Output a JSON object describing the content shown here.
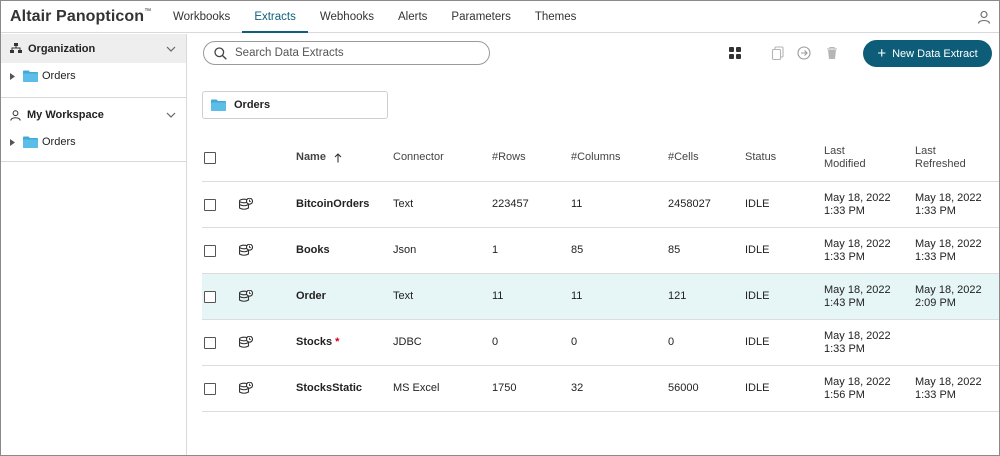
{
  "app": {
    "brand": "Altair Panopticon",
    "tabs": [
      {
        "label": "Workbooks"
      },
      {
        "label": "Extracts"
      },
      {
        "label": "Webhooks"
      },
      {
        "label": "Alerts"
      },
      {
        "label": "Parameters"
      },
      {
        "label": "Themes"
      }
    ],
    "active_tab": "Extracts"
  },
  "sidebar": {
    "organization": {
      "label": "Organization",
      "items": [
        {
          "label": "Orders"
        }
      ]
    },
    "workspace": {
      "label": "My Workspace",
      "items": [
        {
          "label": "Orders"
        }
      ]
    }
  },
  "toolbar": {
    "search_placeholder": "Search Data Extracts",
    "new_button_label": "New Data Extract"
  },
  "current_folder": "Orders",
  "table": {
    "headers": {
      "name": "Name",
      "connector": "Connector",
      "rows": "#Rows",
      "columns": "#Columns",
      "cells": "#Cells",
      "status": "Status",
      "modified_1": "Last",
      "modified_2": "Modified",
      "refreshed_1": "Last",
      "refreshed_2": "Refreshed"
    },
    "rows": [
      {
        "name": "BitcoinOrders",
        "required": "",
        "connector": "Text",
        "rows": "223457",
        "columns": "11",
        "cells": "2458027",
        "status": "IDLE",
        "modified_date": "May 18, 2022",
        "modified_time": "1:33 PM",
        "refreshed_date": "May 18, 2022",
        "refreshed_time": "1:33 PM"
      },
      {
        "name": "Books",
        "required": "",
        "connector": "Json",
        "rows": "1",
        "columns": "85",
        "cells": "85",
        "status": "IDLE",
        "modified_date": "May 18, 2022",
        "modified_time": "1:33 PM",
        "refreshed_date": "May 18, 2022",
        "refreshed_time": "1:33 PM"
      },
      {
        "name": "Order",
        "required": "",
        "connector": "Text",
        "rows": "11",
        "columns": "11",
        "cells": "121",
        "status": "IDLE",
        "modified_date": "May 18, 2022",
        "modified_time": "1:43 PM",
        "refreshed_date": "May 18, 2022",
        "refreshed_time": "2:09 PM"
      },
      {
        "name": "Stocks",
        "required": "*",
        "connector": "JDBC",
        "rows": "0",
        "columns": "0",
        "cells": "0",
        "status": "IDLE",
        "modified_date": "May 18, 2022",
        "modified_time": "1:33 PM",
        "refreshed_date": "",
        "refreshed_time": ""
      },
      {
        "name": "StocksStatic",
        "required": "",
        "connector": "MS Excel",
        "rows": "1750",
        "columns": "32",
        "cells": "56000",
        "status": "IDLE",
        "modified_date": "May 18, 2022",
        "modified_time": "1:56 PM",
        "refreshed_date": "May 18, 2022",
        "refreshed_time": "1:33 PM"
      }
    ],
    "selected_row": 2
  },
  "colors": {
    "accent": "#0d5d78",
    "selected_row": "#e6f5f5",
    "folder": "#3fa9d9",
    "required": "#d0021b"
  }
}
